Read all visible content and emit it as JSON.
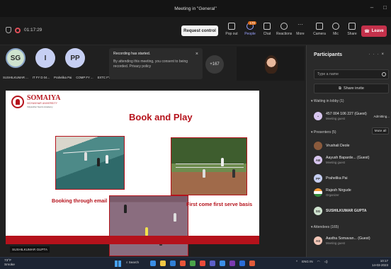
{
  "window": {
    "title": "Meeting in \"General\"",
    "controls": [
      "–",
      "□"
    ]
  },
  "toolbar": {
    "timer": "01:17:29",
    "request_control": "Request control",
    "buttons": [
      {
        "label": "Pop out",
        "icon": "pop-out-icon"
      },
      {
        "label": "People",
        "icon": "people-icon",
        "badge": "170"
      },
      {
        "label": "Chat",
        "icon": "chat-icon"
      },
      {
        "label": "Reactions",
        "icon": "reactions-icon"
      },
      {
        "label": "More",
        "icon": "more-icon"
      },
      {
        "label": "Camera",
        "icon": "camera-off-icon"
      },
      {
        "label": "Mic",
        "icon": "mic-off-icon"
      },
      {
        "label": "Share",
        "icon": "share-icon"
      }
    ],
    "leave": "Leave"
  },
  "stage": {
    "avatars": [
      "SG",
      "I",
      "PP"
    ],
    "name_labels": [
      "SUSHILKUMAR ...",
      "IT FY D 04...",
      "Prahelika Pai",
      "COMP FY ...",
      "EXTC FY F...",
      "Rajesh Nirg..."
    ],
    "recording_notice": {
      "title": "Recording has started.",
      "body": "By attending this meeting, you consent to being recorded. Privacy policy"
    },
    "more_participants": "+167",
    "speaker": "SUSHILKUMAR GUPTA"
  },
  "slide": {
    "logo_name": "SOMAIYA",
    "logo_sub": "VIDYAVIHAR UNIVERSITY",
    "logo_tag": "Vidyavihar Sports Academy",
    "title": "Book and Play",
    "caption_left": "Booking through email",
    "caption_right": "First come first serve basis"
  },
  "panel": {
    "title": "Participants",
    "search_placeholder": "Type a name",
    "share_invite": "Share invite",
    "waiting_header": "Waiting in lobby (1)",
    "waiting": [
      {
        "name": "457 004 106 227 (Guest)",
        "role": "Meeting guest",
        "action": "Admitting..."
      }
    ],
    "presenters_header": "Presenters (5)",
    "mute_all": "Mute all",
    "presenters": [
      {
        "name": "Vrushali Deole",
        "role": "",
        "initials": ""
      },
      {
        "name": "Aayush Bapardekar (Guest)",
        "display": "Aayush Baparde... (Guest)",
        "role": "Meeting guest",
        "initials": "AB"
      },
      {
        "name": "Prahelika Pai",
        "role": "",
        "initials": "PP"
      },
      {
        "name": "Rajesh Nirgude",
        "role": "Organizer",
        "initials": ""
      },
      {
        "name": "SUSHILKUMAR GUPTA",
        "role": "",
        "initials": "SG"
      }
    ],
    "attendees_header": "Attendees (165)",
    "attendees": [
      {
        "name": "Aastha Somavan... (Guest)",
        "role": "Meeting guest",
        "initials": "AS"
      }
    ]
  },
  "taskbar": {
    "weather_temp": "73°F",
    "weather_desc": "Smoke",
    "search": "Search",
    "lang": "ENG",
    "lang_sub": "IN",
    "time": "10:17",
    "date": "14-03-2023"
  }
}
